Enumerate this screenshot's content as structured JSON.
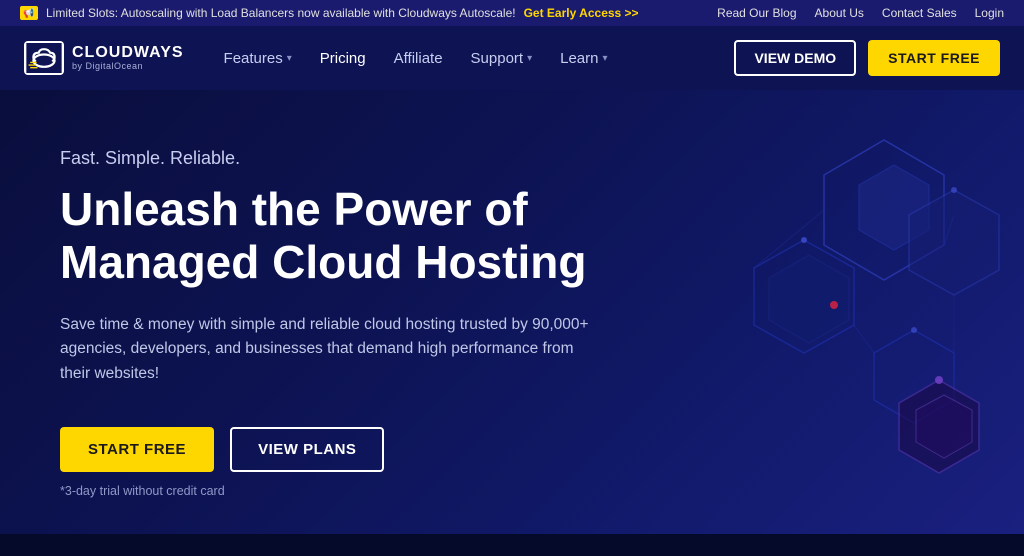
{
  "topbar": {
    "announcement": "Limited Slots: Autoscaling with Load Balancers now available with Cloudways Autoscale!",
    "cta_link": "Get Early Access >>",
    "links": [
      {
        "label": "Read Our Blog",
        "name": "read-blog"
      },
      {
        "label": "About Us",
        "name": "about-us"
      },
      {
        "label": "Contact Sales",
        "name": "contact-sales"
      },
      {
        "label": "Login",
        "name": "login"
      }
    ]
  },
  "navbar": {
    "logo": {
      "brand": "CLOUDWAYS",
      "sub": "by DigitalOcean"
    },
    "nav_items": [
      {
        "label": "Features",
        "has_dropdown": true,
        "name": "features-nav"
      },
      {
        "label": "Pricing",
        "has_dropdown": false,
        "name": "pricing-nav"
      },
      {
        "label": "Affiliate",
        "has_dropdown": false,
        "name": "affiliate-nav"
      },
      {
        "label": "Support",
        "has_dropdown": true,
        "name": "support-nav"
      },
      {
        "label": "Learn",
        "has_dropdown": true,
        "name": "learn-nav"
      }
    ],
    "btn_demo": "VIEW DEMO",
    "btn_start": "START FREE"
  },
  "hero": {
    "tagline": "Fast. Simple. Reliable.",
    "title": "Unleash the Power of Managed Cloud Hosting",
    "description": "Save time & money with simple and reliable cloud hosting trusted by 90,000+ agencies, developers, and businesses that demand high performance from their websites!",
    "btn_start": "START FREE",
    "btn_plans": "VIEW PLANS",
    "trial_note": "*3-day trial without credit card"
  }
}
